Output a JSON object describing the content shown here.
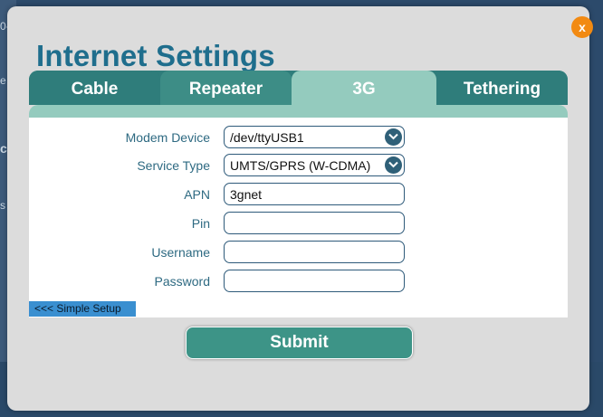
{
  "background": {
    "fragments": [
      "0-",
      "e",
      "c",
      "s"
    ]
  },
  "dialog": {
    "close_label": "x",
    "title": "Internet Settings",
    "tabs": [
      {
        "label": "Cable",
        "active": false
      },
      {
        "label": "Repeater",
        "active": false
      },
      {
        "label": "3G",
        "active": true
      },
      {
        "label": "Tethering",
        "active": false
      }
    ],
    "form": {
      "modem_device": {
        "label": "Modem Device",
        "value": "/dev/ttyUSB1"
      },
      "service_type": {
        "label": "Service Type",
        "value": "UMTS/GPRS (W-CDMA)"
      },
      "apn": {
        "label": "APN",
        "value": "3gnet"
      },
      "pin": {
        "label": "Pin",
        "value": ""
      },
      "username": {
        "label": "Username",
        "value": ""
      },
      "password": {
        "label": "Password",
        "value": ""
      }
    },
    "simple_setup_link": "<<< Simple Setup",
    "submit_label": "Submit"
  },
  "colors": {
    "title": "#1f6e8d",
    "tab_inactive": "#2f7d7b",
    "tab_active": "#94cbbe",
    "close_button": "#f28a12",
    "submit": "#3d9487",
    "link_bg": "#3a8fd0"
  }
}
